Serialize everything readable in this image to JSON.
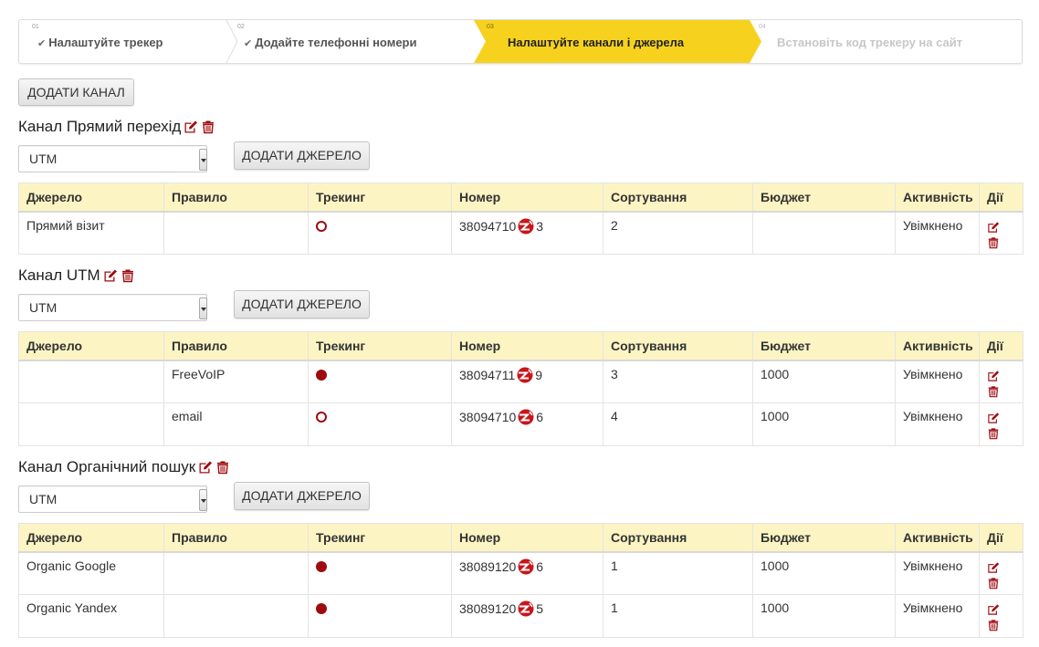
{
  "wizard": {
    "steps": [
      {
        "num": "01",
        "label": "Налаштуйте трекер"
      },
      {
        "num": "02",
        "label": "Додайте телефонні номери"
      },
      {
        "num": "03",
        "label": "Налаштуйте канали і джерела"
      },
      {
        "num": "04",
        "label": "Встановіть код трекеру на сайт"
      }
    ],
    "active_color": "#f6d21f"
  },
  "add_channel_label": "ДОДАТИ КАНАЛ",
  "add_source_label": "ДОДАТИ ДЖЕРЕЛО",
  "table_headers": [
    "Джерело",
    "Правило",
    "Трекинг",
    "Номер",
    "Сортування",
    "Бюджет",
    "Активність",
    "Дії"
  ],
  "channels": [
    {
      "title": "Канал Прямий перехід",
      "select_value": "UTM",
      "rows": [
        {
          "source": "Прямий візит",
          "rule": "",
          "tracking": "off",
          "number_a": "38094710",
          "number_b": "3",
          "sort": "2",
          "budget": "",
          "activity": "Увімкнено"
        }
      ]
    },
    {
      "title": "Канал UTM",
      "select_value": "UTM",
      "rows": [
        {
          "source": "",
          "rule": "FreeVoIP",
          "tracking": "on",
          "number_a": "38094711",
          "number_b": "9",
          "sort": "3",
          "budget": "1000",
          "activity": "Увімкнено"
        },
        {
          "source": "",
          "rule": "email",
          "tracking": "off",
          "number_a": "38094710",
          "number_b": "6",
          "sort": "4",
          "budget": "1000",
          "activity": "Увімкнено"
        }
      ]
    },
    {
      "title": "Канал Органічний пошук",
      "select_value": "UTM",
      "rows": [
        {
          "source": "Organic Google",
          "rule": "",
          "tracking": "on",
          "number_a": "38089120",
          "number_b": "6",
          "sort": "1",
          "budget": "1000",
          "activity": "Увімкнено"
        },
        {
          "source": "Organic Yandex",
          "rule": "",
          "tracking": "on",
          "number_a": "38089120",
          "number_b": "5",
          "sort": "1",
          "budget": "1000",
          "activity": "Увімкнено"
        }
      ]
    }
  ],
  "colors": {
    "accent": "#9e0b0f",
    "header_bg": "#fdf4c4"
  },
  "icons": {
    "edit": "edit-icon",
    "delete": "trash-icon",
    "check": "check-icon",
    "masked_number": "masked-digits-icon"
  }
}
